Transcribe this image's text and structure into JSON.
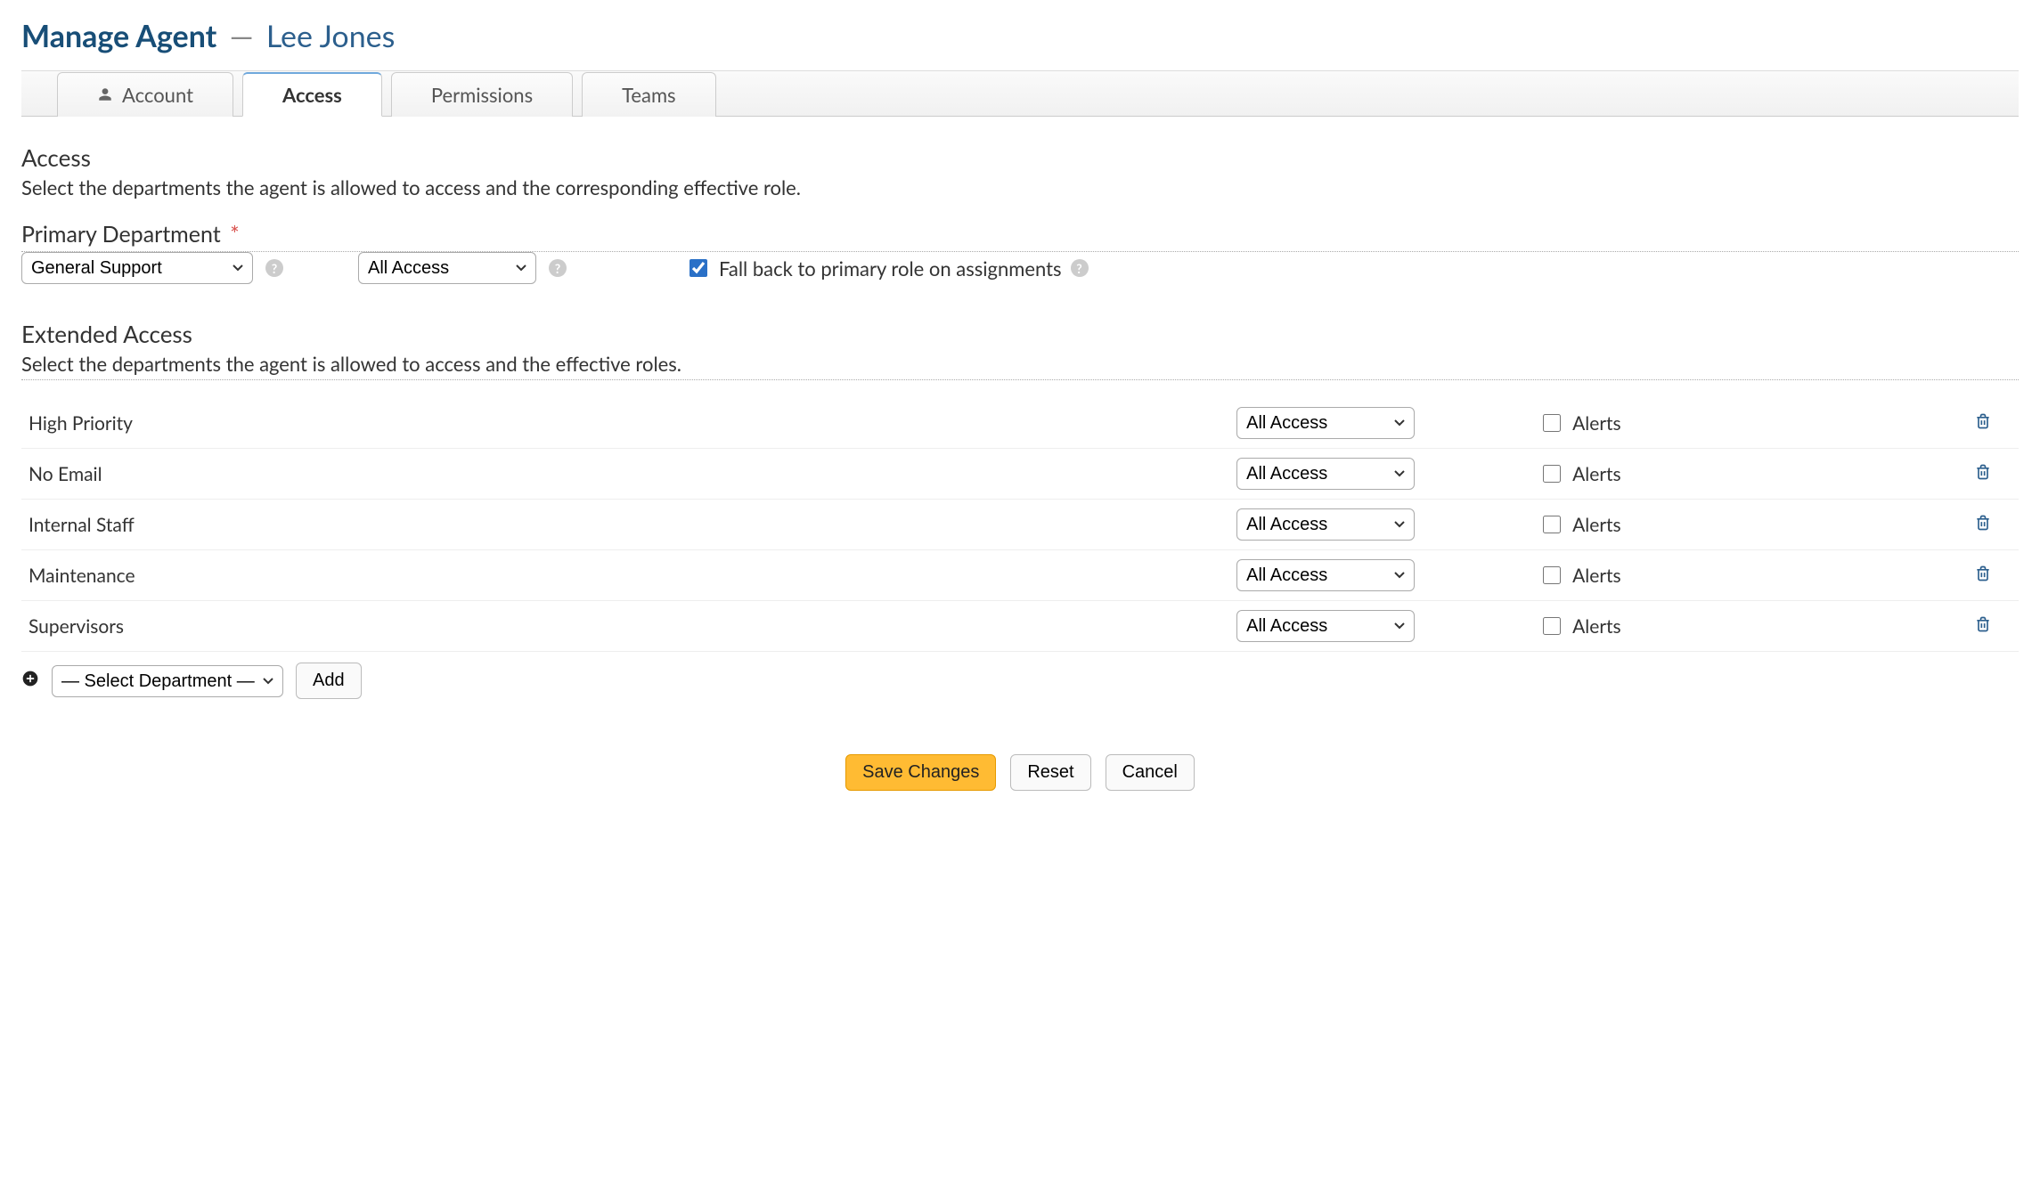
{
  "page": {
    "title_main": "Manage Agent",
    "title_sub": "Lee Jones"
  },
  "tabs": [
    {
      "id": "account",
      "label": "Account",
      "active": false,
      "icon": "user"
    },
    {
      "id": "access",
      "label": "Access",
      "active": true,
      "icon": null
    },
    {
      "id": "permissions",
      "label": "Permissions",
      "active": false,
      "icon": null
    },
    {
      "id": "teams",
      "label": "Teams",
      "active": false,
      "icon": null
    }
  ],
  "access": {
    "heading": "Access",
    "description": "Select the departments the agent is allowed to access and the corresponding effective role."
  },
  "primary": {
    "label": "Primary Department",
    "required_marker": "*",
    "department_value": "General Support",
    "role_value": "All Access",
    "fallback_checked": true,
    "fallback_label": "Fall back to primary role on assignments"
  },
  "extended": {
    "heading": "Extended Access",
    "description": "Select the departments the agent is allowed to access and the effective roles.",
    "alerts_label": "Alerts",
    "rows": [
      {
        "department": "High Priority",
        "role": "All Access",
        "alerts": false
      },
      {
        "department": "No Email",
        "role": "All Access",
        "alerts": false
      },
      {
        "department": "Internal Staff",
        "role": "All Access",
        "alerts": false
      },
      {
        "department": "Maintenance",
        "role": "All Access",
        "alerts": false
      },
      {
        "department": "Supervisors",
        "role": "All Access",
        "alerts": false
      }
    ],
    "add": {
      "select_placeholder": "— Select Department —",
      "button": "Add"
    }
  },
  "footer": {
    "save": "Save Changes",
    "reset": "Reset",
    "cancel": "Cancel"
  }
}
